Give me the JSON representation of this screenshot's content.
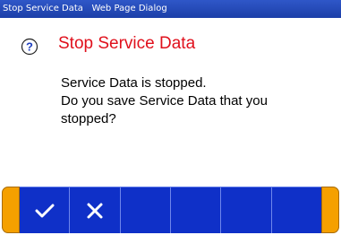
{
  "window": {
    "title": "Stop Service Data   Web Page Dialog"
  },
  "dialog": {
    "icon": "question-icon",
    "heading": "Stop Service Data",
    "message_lines": [
      "Service Data is stopped.",
      "Do you save Service Data that you",
      "stopped?"
    ]
  },
  "toolbar": {
    "buttons": [
      {
        "icon": "checkmark-icon"
      },
      {
        "icon": "cross-icon"
      },
      {
        "icon": ""
      },
      {
        "icon": ""
      },
      {
        "icon": ""
      },
      {
        "icon": ""
      }
    ]
  },
  "colors": {
    "title_bar": "#1c3fa8",
    "heading": "#e0101c",
    "toolbar": "#0f30c8",
    "end_caps": "#f5a000"
  }
}
